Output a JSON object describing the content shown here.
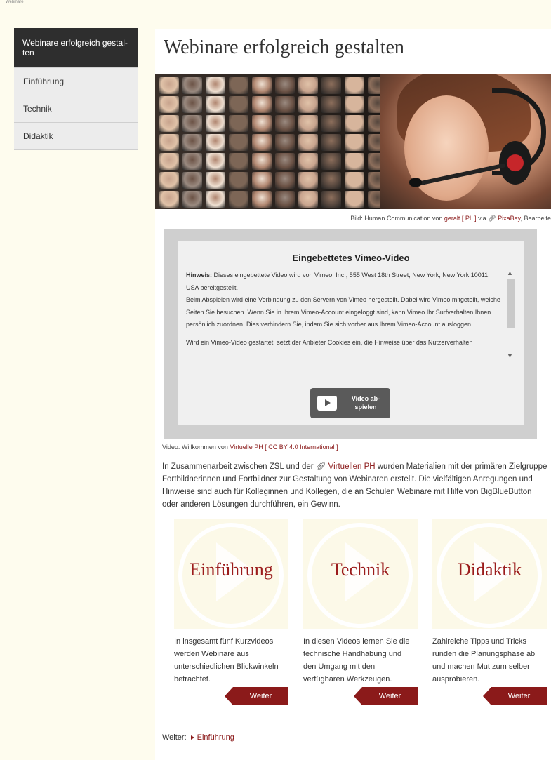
{
  "topbar": {
    "text": "Webinare"
  },
  "sidebar": {
    "items": [
      {
        "label": "Webinare erfolgreich gestal-ten",
        "active": true
      },
      {
        "label": "Einführung"
      },
      {
        "label": "Technik"
      },
      {
        "label": "Didaktik"
      }
    ]
  },
  "main": {
    "title": "Webinare erfolgreich gestalten",
    "image_credit": {
      "prefix": "Bild: Human Communication von",
      "author": "geralt",
      "license": "[ PL ]",
      "via": "via",
      "source": "PixaBay",
      "suffix": "Bearbeite"
    },
    "vimeo": {
      "title": "Eingebettetes Vimeo-Video",
      "note_label": "Hinweis:",
      "note_text": "Dieses eingebettete Video wird von Vimeo, Inc., 555 West 18th Street, New York, New York 10011, USA bereitgestellt.",
      "para1": "Beim Abspielen wird eine Verbindung zu den Servern von Vimeo hergestellt. Dabei wird Vimeo mitgeteilt, welche Seiten Sie besuchen. Wenn Sie in Ihrem Vimeo-Account eingeloggt sind, kann Vimeo Ihr Surfverhalten Ihnen persönlich zuordnen. Dies verhindern Sie, indem Sie sich vorher aus Ihrem Vimeo-Account ausloggen.",
      "para2": "Wird ein Vimeo-Video gestartet, setzt der Anbieter Cookies ein, die Hinweise über das Nutzerverhalten",
      "play_label": "Video ab-spielen"
    },
    "video_credit": {
      "prefix": "Video: Willkommen von",
      "author": "Virtuelle PH",
      "license": "[ CC BY 4.0 International ]"
    },
    "intro": {
      "before_link": "In Zusammenarbeit zwischen ZSL und der",
      "link": "Virtuellen PH",
      "after_link": "wurden Materialien mit der primären Zielgruppe Fortbildnerinnen und Fortbildner zur Gestaltung von Webinaren erstellt. Die vielfältigen Anregungen und Hinweise sind auch für Kolleginnen und Kollegen, die an Schulen Webinare mit Hilfe von BigBlueButton oder anderen Lösungen durchführen, ein Gewinn."
    },
    "cards": [
      {
        "title": "Einführung",
        "text": "In insgesamt fünf Kurzvideos werden Webinare aus unterschiedlichen Blickwinkeln betrachtet.",
        "button": "Weiter"
      },
      {
        "title": "Technik",
        "text": "In diesen Videos lernen Sie die technische Handhabung und den Umgang mit den verfügbaren Werkzeugen.",
        "button": "Weiter"
      },
      {
        "title": "Didaktik",
        "text": "Zahlreiche Tipps und Tricks runden die Planungsphase ab und machen Mut zum selber ausprobieren.",
        "button": "Weiter"
      }
    ],
    "next": {
      "label": "Weiter:",
      "link": "Einführung"
    }
  },
  "colors": {
    "accent": "#8b1a1a",
    "sidebar_active": "#2e2e2e",
    "page_bg": "#fefcee"
  }
}
